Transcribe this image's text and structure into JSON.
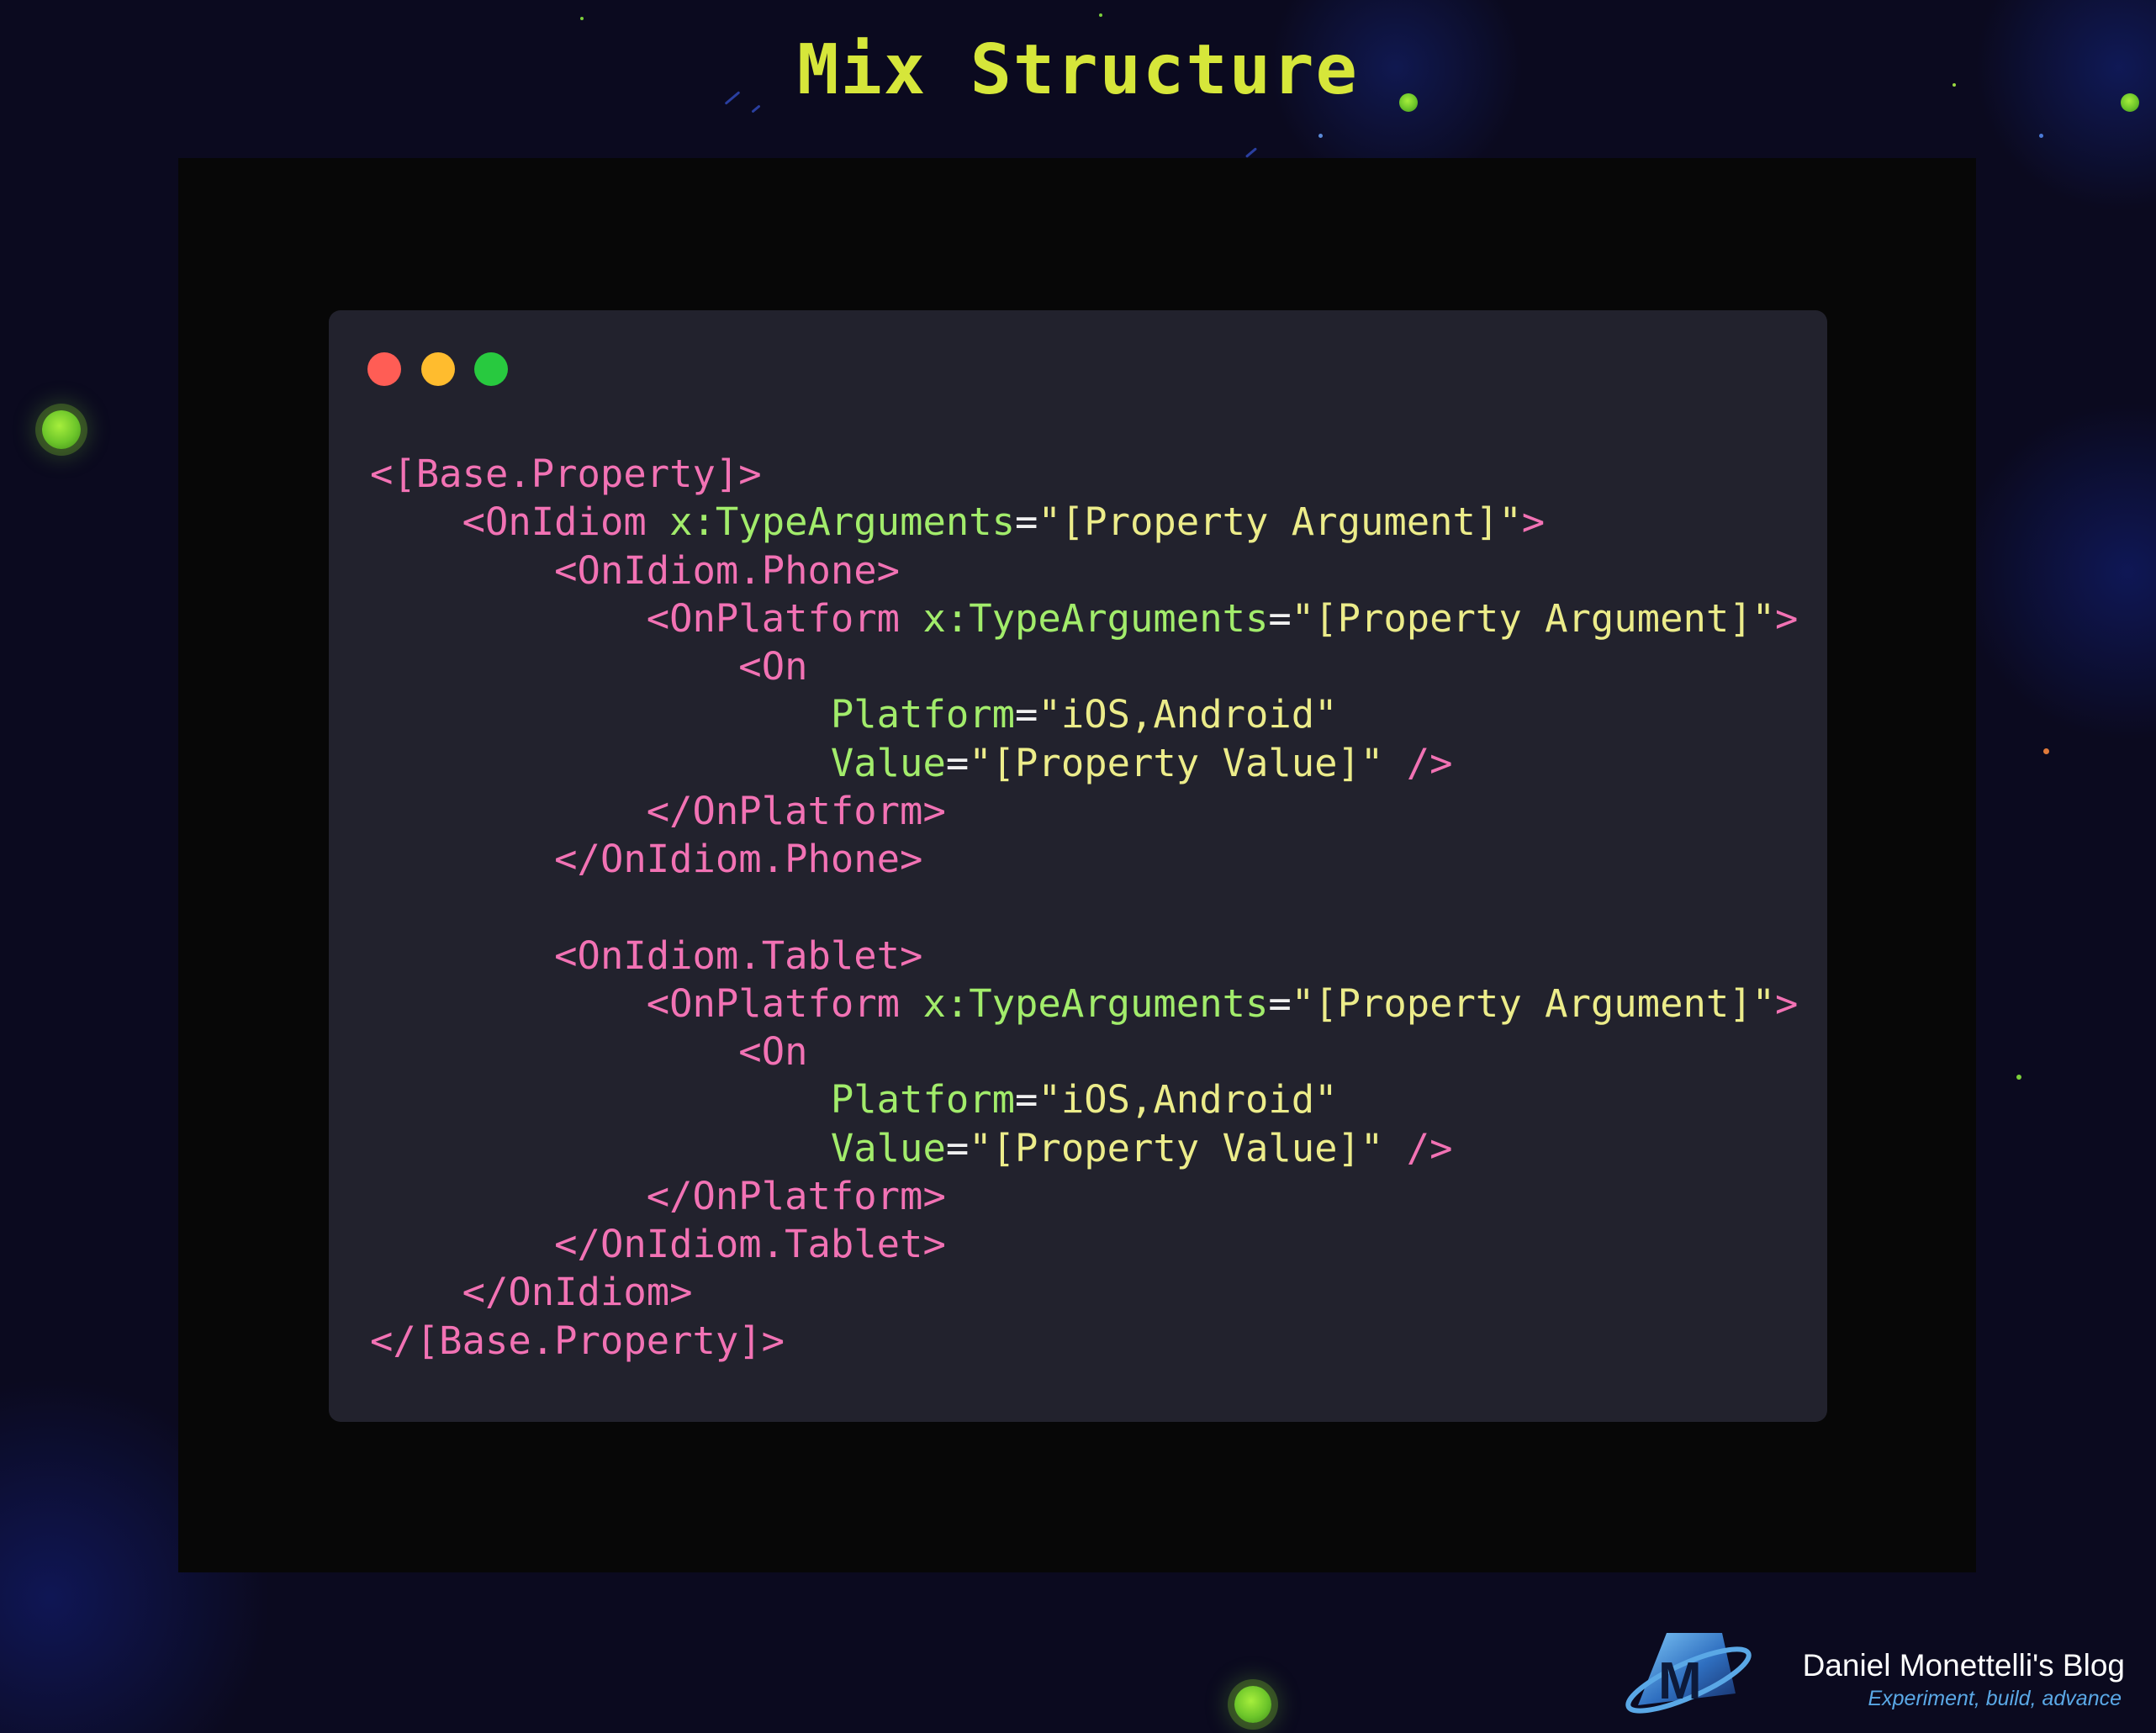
{
  "title": "Mix Structure",
  "colors": {
    "background": "#0b0a1f",
    "title": "#d6e63a",
    "frame": "#070707",
    "code_window": "#22222d",
    "tag": "#f272b4",
    "attribute": "#a2ec6b",
    "string": "#ecec8a",
    "punctuation": "#f0f0f0",
    "orb": "#8fdc36"
  },
  "window_controls": [
    {
      "name": "close",
      "color": "#ff5d55"
    },
    {
      "name": "minimize",
      "color": "#ffbc2e"
    },
    {
      "name": "maximize",
      "color": "#28c93f"
    }
  ],
  "code": {
    "lines": [
      "<[Base.Property]>",
      "    <OnIdiom x:TypeArguments=\"[Property Argument]\">",
      "        <OnIdiom.Phone>",
      "            <OnPlatform x:TypeArguments=\"[Property Argument]\">",
      "                <On",
      "                    Platform=\"iOS,Android\"",
      "                    Value=\"[Property Value]\" />",
      "            </OnPlatform>",
      "        </OnIdiom.Phone>",
      "",
      "        <OnIdiom.Tablet>",
      "            <OnPlatform x:TypeArguments=\"[Property Argument]\">",
      "                <On",
      "                    Platform=\"iOS,Android\"",
      "                    Value=\"[Property Value]\" />",
      "            </OnPlatform>",
      "        </OnIdiom.Tablet>",
      "    </OnIdiom>",
      "</[Base.Property]>"
    ]
  },
  "brand": {
    "logo_letter": "M",
    "name": "Daniel Monettelli's Blog",
    "tagline": "Experiment, build, advance"
  }
}
